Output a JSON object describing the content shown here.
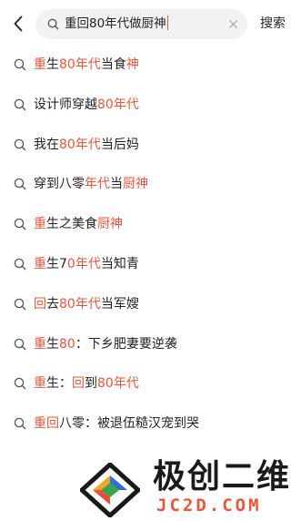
{
  "search": {
    "query": "重回80年代做厨神",
    "button_label": "搜索"
  },
  "colors": {
    "highlight": "#e8573c",
    "text": "#222222",
    "search_bg": "#f2f2f4"
  },
  "suggestions": [
    [
      {
        "t": "重",
        "h": true
      },
      {
        "t": "生",
        "h": false
      },
      {
        "t": "80年代",
        "h": true
      },
      {
        "t": "当食",
        "h": false
      },
      {
        "t": "神",
        "h": true
      }
    ],
    [
      {
        "t": "设计师穿越",
        "h": false
      },
      {
        "t": "80年代",
        "h": true
      }
    ],
    [
      {
        "t": "我在",
        "h": false
      },
      {
        "t": "80年代",
        "h": true
      },
      {
        "t": "当后妈",
        "h": false
      }
    ],
    [
      {
        "t": "穿到八零",
        "h": false
      },
      {
        "t": "年代",
        "h": true
      },
      {
        "t": "当",
        "h": false
      },
      {
        "t": "厨神",
        "h": true
      }
    ],
    [
      {
        "t": "重",
        "h": true
      },
      {
        "t": "生之美食",
        "h": false
      },
      {
        "t": "厨神",
        "h": true
      }
    ],
    [
      {
        "t": "重",
        "h": true
      },
      {
        "t": "生7",
        "h": false
      },
      {
        "t": "0年代",
        "h": true
      },
      {
        "t": "当知青",
        "h": false
      }
    ],
    [
      {
        "t": "回",
        "h": true
      },
      {
        "t": "去",
        "h": false
      },
      {
        "t": "80年代",
        "h": true
      },
      {
        "t": "当军嫂",
        "h": false
      }
    ],
    [
      {
        "t": "重",
        "h": true
      },
      {
        "t": "生",
        "h": false
      },
      {
        "t": "80",
        "h": true
      },
      {
        "t": "：下乡肥妻要逆袭",
        "h": false
      }
    ],
    [
      {
        "t": "重",
        "h": true
      },
      {
        "t": "生：",
        "h": false
      },
      {
        "t": "回",
        "h": true
      },
      {
        "t": "到",
        "h": false
      },
      {
        "t": "80年代",
        "h": true
      }
    ],
    [
      {
        "t": "重回",
        "h": true
      },
      {
        "t": "八零：被退伍糙汉宠到哭",
        "h": false
      }
    ]
  ],
  "watermark": {
    "title": "极创二维",
    "subtitle": "JC2D.COM"
  }
}
